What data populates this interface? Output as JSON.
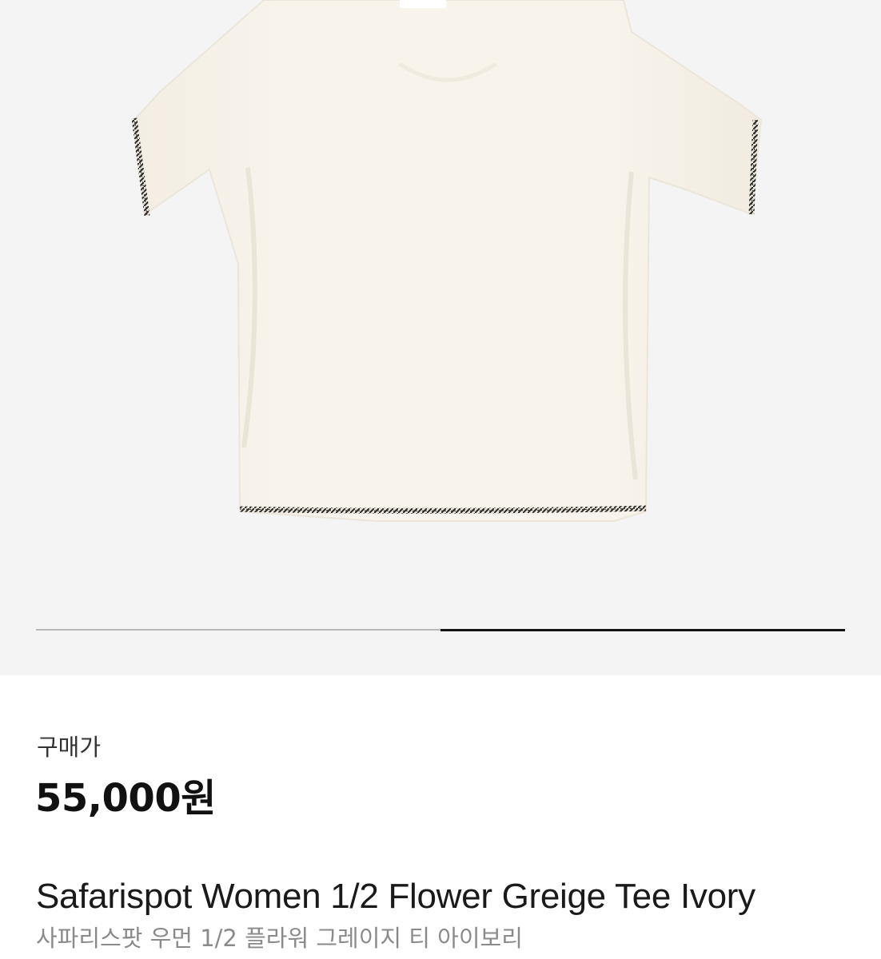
{
  "gallery": {
    "image_subject": "ivory short-sleeve tee with black contrast stitching (back view)",
    "background_color": "#f4f4f4",
    "garment_color": "#f7f2ea",
    "stitch_color": "#2a2a2a",
    "progress": {
      "total_images": 2,
      "current_index": 2,
      "track_color": "#b8b8b8",
      "fill_color": "#111111"
    }
  },
  "price": {
    "label": "구매가",
    "value": "55,000원"
  },
  "product": {
    "name_en": "Safarispot Women 1/2 Flower Greige Tee Ivory",
    "name_ko": "사파리스팟 우먼 1/2 플라워 그레이지 티 아이보리"
  }
}
